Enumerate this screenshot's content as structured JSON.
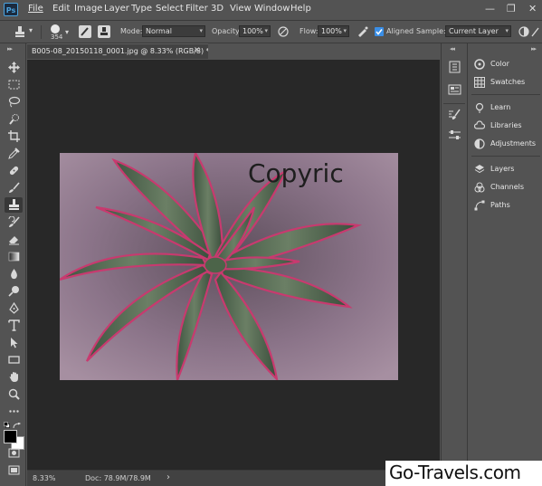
{
  "app": {
    "logo_text": "Ps"
  },
  "menubar": {
    "items": [
      "File",
      "Edit",
      "Image",
      "Layer",
      "Type",
      "Select",
      "Filter",
      "3D",
      "View",
      "Window",
      "Help"
    ],
    "window_controls": {
      "minimize": "—",
      "restore": "❐",
      "close": "✕"
    }
  },
  "options": {
    "brush_size": "354",
    "mode_label": "Mode:",
    "mode_value": "Normal",
    "opacity_label": "Opacity:",
    "opacity_value": "100%",
    "flow_label": "Flow:",
    "flow_value": "100%",
    "aligned_label": "Aligned",
    "aligned_checked": true,
    "sample_label": "Sample:",
    "sample_value": "Current Layer"
  },
  "document": {
    "tab_title": "B005-08_20150118_0001.jpg @ 8.33% (RGB/8) *",
    "close_glyph": "✕",
    "watermark_text": "Copyric"
  },
  "statusbar": {
    "zoom": "8.33%",
    "doc_info": "Doc: 78.9M/78.9M",
    "arrow": "›"
  },
  "panels": {
    "groups": [
      [
        {
          "label": "Color",
          "icon": "color-wheel-icon"
        },
        {
          "label": "Swatches",
          "icon": "grid-icon"
        }
      ],
      [
        {
          "label": "Learn",
          "icon": "bulb-icon"
        },
        {
          "label": "Libraries",
          "icon": "cloud-icon"
        },
        {
          "label": "Adjustments",
          "icon": "half-circle-icon"
        }
      ],
      [
        {
          "label": "Layers",
          "icon": "layers-icon"
        },
        {
          "label": "Channels",
          "icon": "channels-icon"
        },
        {
          "label": "Paths",
          "icon": "paths-icon"
        }
      ]
    ]
  },
  "tools": [
    "move-tool",
    "marquee-tool",
    "lasso-tool",
    "quick-select-tool",
    "crop-tool",
    "eyedropper-tool",
    "healing-brush-tool",
    "brush-tool",
    "clone-stamp-tool",
    "history-brush-tool",
    "eraser-tool",
    "gradient-tool",
    "blur-tool",
    "dodge-tool",
    "pen-tool",
    "type-tool",
    "path-select-tool",
    "rectangle-tool",
    "hand-tool",
    "zoom-tool",
    "more-tools"
  ],
  "site_watermark": "Go-Travels.com",
  "colors": {
    "foreground": "#000000",
    "background": "#ffffff",
    "canvas_bg": "#282828",
    "ui_bg": "#535353"
  }
}
